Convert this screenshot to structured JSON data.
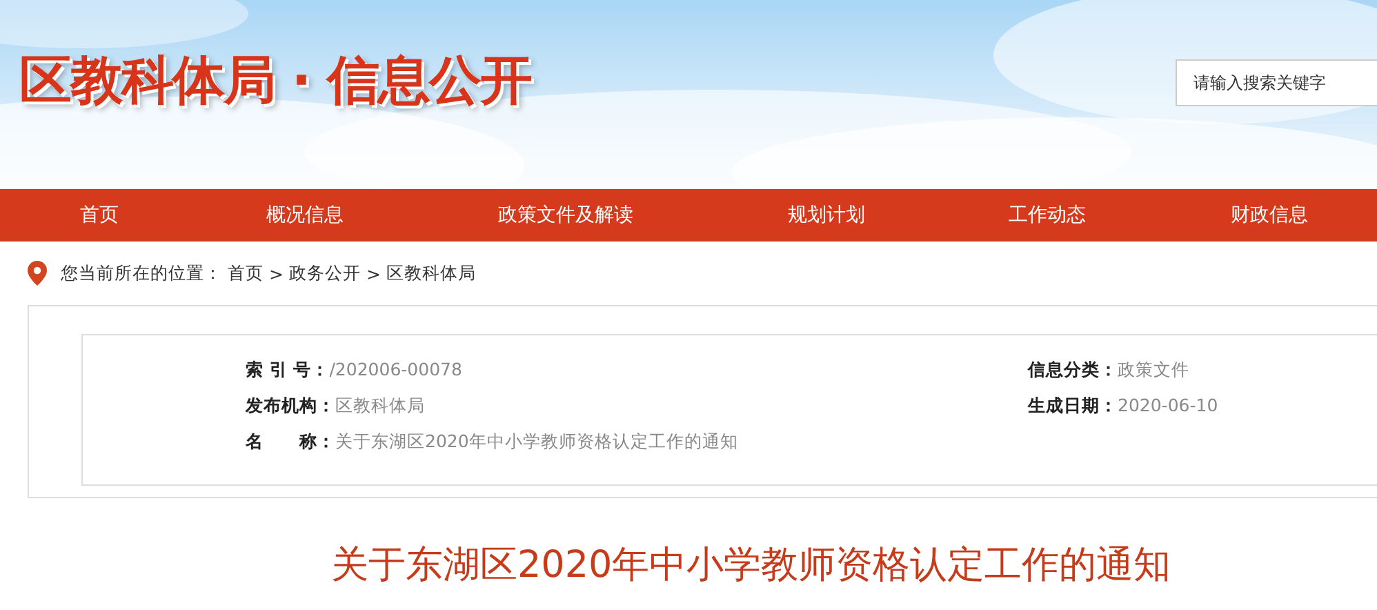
{
  "header": {
    "site_title": "区教科体局 · 信息公开",
    "search": {
      "placeholder": "请输入搜索关键字"
    }
  },
  "nav": {
    "items": [
      {
        "label": "首页"
      },
      {
        "label": "概况信息"
      },
      {
        "label": "政策文件及解读"
      },
      {
        "label": "规划计划"
      },
      {
        "label": "工作动态"
      },
      {
        "label": "财政信息"
      }
    ]
  },
  "breadcrumb": {
    "prefix": "您当前所在的位置：",
    "items": [
      "首页",
      "政务公开",
      "区教科体局"
    ],
    "separator": ">"
  },
  "info": {
    "left": [
      {
        "label": "索 引 号：",
        "value": "/202006-00078"
      },
      {
        "label": "发布机构：",
        "value": "区教科体局"
      },
      {
        "label": "名　　称：",
        "value": "关于东湖区2020年中小学教师资格认定工作的通知"
      }
    ],
    "right": [
      {
        "label": "信息分类：",
        "value": "政策文件"
      },
      {
        "label": "生成日期：",
        "value": "2020-06-10"
      }
    ]
  },
  "article": {
    "title": "关于东湖区2020年中小学教师资格认定工作的通知"
  }
}
